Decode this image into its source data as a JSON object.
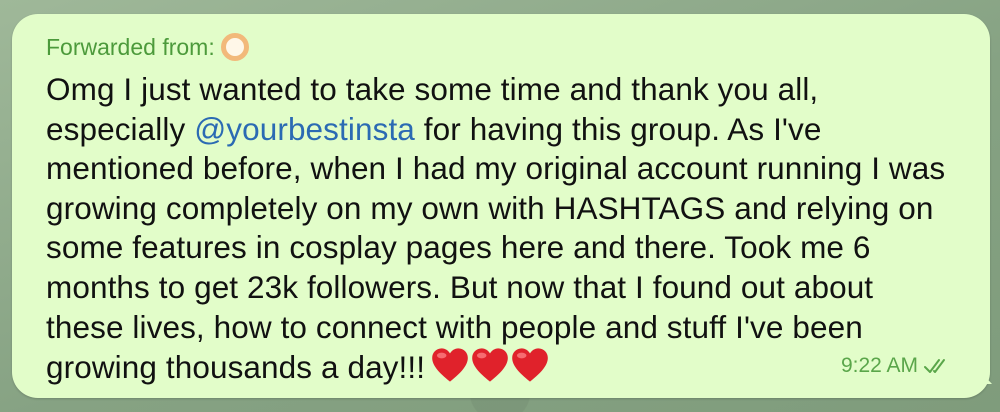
{
  "message": {
    "forwarded_label": "Forwarded from:",
    "lines": [
      "Omg I just wanted to take some time and thank you all,",
      "for having this group. As I've",
      "mentioned before, when I had my original account running I was",
      "growing completely on my own with HASHTAGS and relying on",
      "some features in cosplay pages here and there. Took me 6",
      "months to get 23k followers. But now that I found out about",
      "these lives, how to connect with people and stuff I've been",
      "growing thousands a day!!!"
    ],
    "line2_prefix": "especially",
    "mention": "@yourbestinsta",
    "emoji": [
      "heart-emoji",
      "heart-emoji",
      "heart-emoji"
    ],
    "time": "9:22 AM",
    "status_icon": "double-check-icon",
    "colors": {
      "bubble": "#e2fdc9",
      "forwarded": "#4c9a3b",
      "mention": "#2b6ab3",
      "time": "#5aa64a",
      "heart": "#e0222b"
    }
  }
}
